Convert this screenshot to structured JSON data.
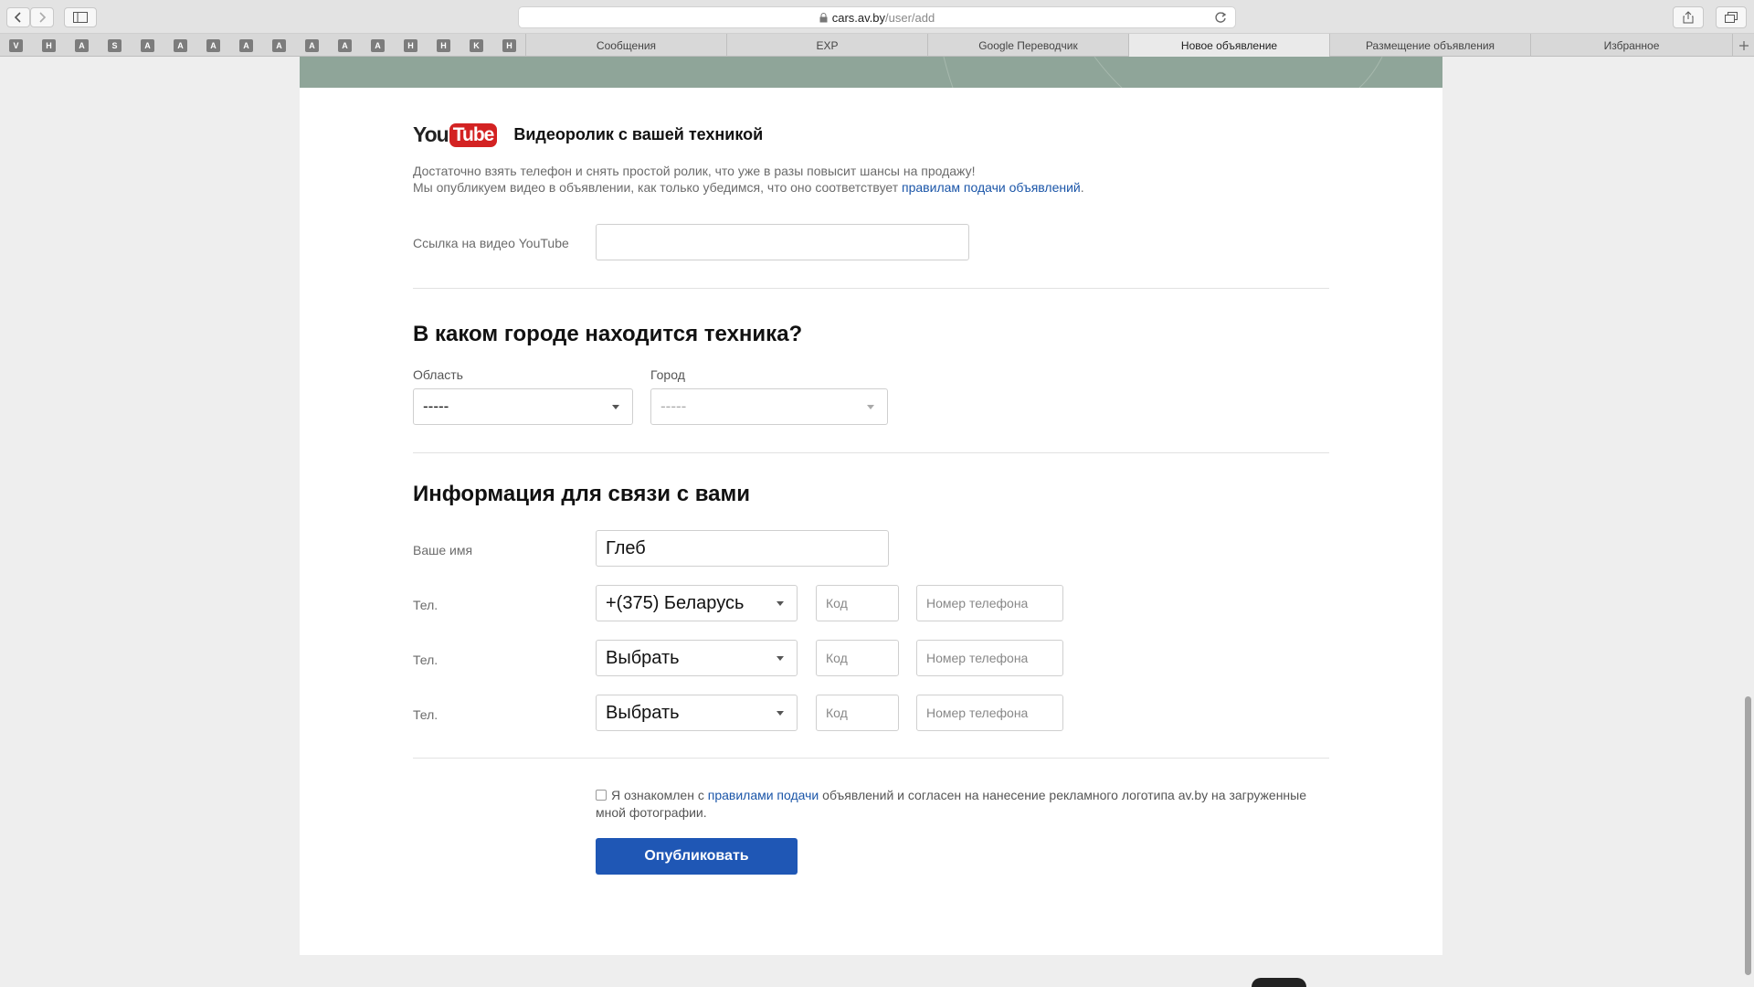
{
  "browser": {
    "url_host": "cars.av.by",
    "url_path": "/user/add",
    "favorites": [
      "V",
      "H",
      "A",
      "S",
      "A",
      "A",
      "A",
      "A",
      "A",
      "A",
      "A",
      "A",
      "H",
      "H",
      "K",
      "H"
    ],
    "tabs": [
      {
        "label": "Сообщения",
        "active": false
      },
      {
        "label": "EXP",
        "active": false
      },
      {
        "label": "Google Переводчик",
        "active": false
      },
      {
        "label": "Новое объявление",
        "active": true
      },
      {
        "label": "Размещение объявления",
        "active": false
      },
      {
        "label": "Избранное",
        "active": false
      }
    ]
  },
  "video": {
    "logo_you": "You",
    "logo_tube": "Tube",
    "title": "Видеоролик с вашей техникой",
    "desc_line1": "Достаточно взять телефон и снять простой ролик, что уже в разы повысит шансы на продажу!",
    "desc_line2_prefix": "Мы опубликуем видео в объявлении, как только убедимся, что оно соответствует ",
    "desc_link": "правилам подачи объявлений",
    "desc_line2_suffix": ".",
    "link_label": "Ссылка на видео YouTube",
    "link_value": ""
  },
  "location": {
    "heading": "В каком городе находится техника?",
    "region_label": "Область",
    "region_value": "-----",
    "city_label": "Город",
    "city_value": "-----"
  },
  "contact": {
    "heading": "Информация для связи с вами",
    "name_label": "Ваше имя",
    "name_value": "Глеб",
    "phones": [
      {
        "label": "Тел.",
        "country": "+(375) Беларусь",
        "code_placeholder": "Код",
        "number_placeholder": "Номер телефона"
      },
      {
        "label": "Тел.",
        "country": "Выбрать",
        "code_placeholder": "Код",
        "number_placeholder": "Номер телефона"
      },
      {
        "label": "Тел.",
        "country": "Выбрать",
        "code_placeholder": "Код",
        "number_placeholder": "Номер телефона"
      }
    ]
  },
  "agreement": {
    "prefix": "Я ознакомлен с ",
    "link": "правилами подачи",
    "suffix": " объявлений и согласен на нанесение рекламного логотипа av.by на загруженные мной фотографии.",
    "checked": false
  },
  "publish_label": "Опубликовать",
  "colors": {
    "accent": "#1f57b5",
    "link": "#1a55a8",
    "banner": "#8fa599",
    "youtube_red": "#d32222"
  }
}
